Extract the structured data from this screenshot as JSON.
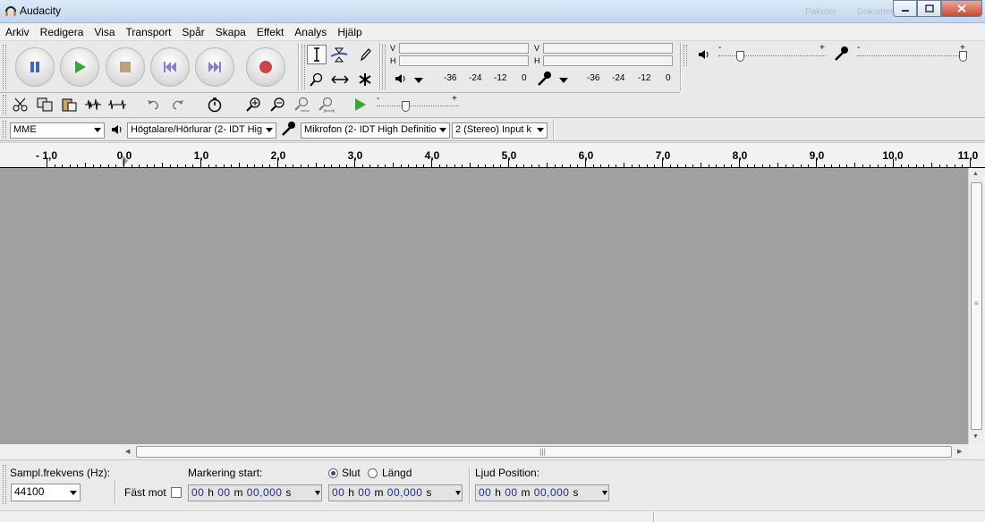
{
  "window": {
    "title": "Audacity",
    "ghost_labels": [
      "Paketer",
      "Dokument"
    ]
  },
  "menu": [
    "Arkiv",
    "Redigera",
    "Visa",
    "Transport",
    "Spår",
    "Skapa",
    "Effekt",
    "Analys",
    "Hjälp"
  ],
  "meters": {
    "play_label_v": "V",
    "play_label_h": "H",
    "rec_label_v": "V",
    "rec_label_h": "H",
    "play_ticks": [
      "-36",
      "-24",
      "-12",
      "0"
    ],
    "rec_ticks": [
      "-36",
      "-24",
      "-12",
      "0"
    ]
  },
  "mixer": {
    "minus": "-",
    "plus": "+",
    "minus2": "-",
    "plus2": "+",
    "output_volume": 0.2,
    "input_volume": 0.97
  },
  "play_at_speed": {
    "minus": "-",
    "plus": "+",
    "speed": 0.35
  },
  "devices": {
    "host": "MME",
    "output": "Högtalare/Hörlurar (2- IDT Hig",
    "input": "Mikrofon (2- IDT High Definitio",
    "channels": "2 (Stereo) Input k"
  },
  "ruler": {
    "labels": [
      "- 1,0",
      "0,0",
      "1,0",
      "2,0",
      "3,0",
      "4,0",
      "5,0",
      "6,0",
      "7,0",
      "8,0",
      "9,0",
      "10,0",
      "11,0"
    ]
  },
  "selection_bar": {
    "rate_label": "Sampl.frekvens (Hz):",
    "rate_value": "44100",
    "snap_label": "Fäst mot",
    "start_label": "Markering start:",
    "end_label": "Slut",
    "length_label": "Längd",
    "position_label": "Ljud Position:",
    "time_h": "00",
    "time_m": "00",
    "time_s": "00,000",
    "unit_h": "h",
    "unit_m": "m",
    "unit_s": "s"
  },
  "colors": {
    "track_bg": "#a0a0a0",
    "accent_blue": "#1d2f9b",
    "play_green": "#3aa63a",
    "record_red": "#c44"
  }
}
